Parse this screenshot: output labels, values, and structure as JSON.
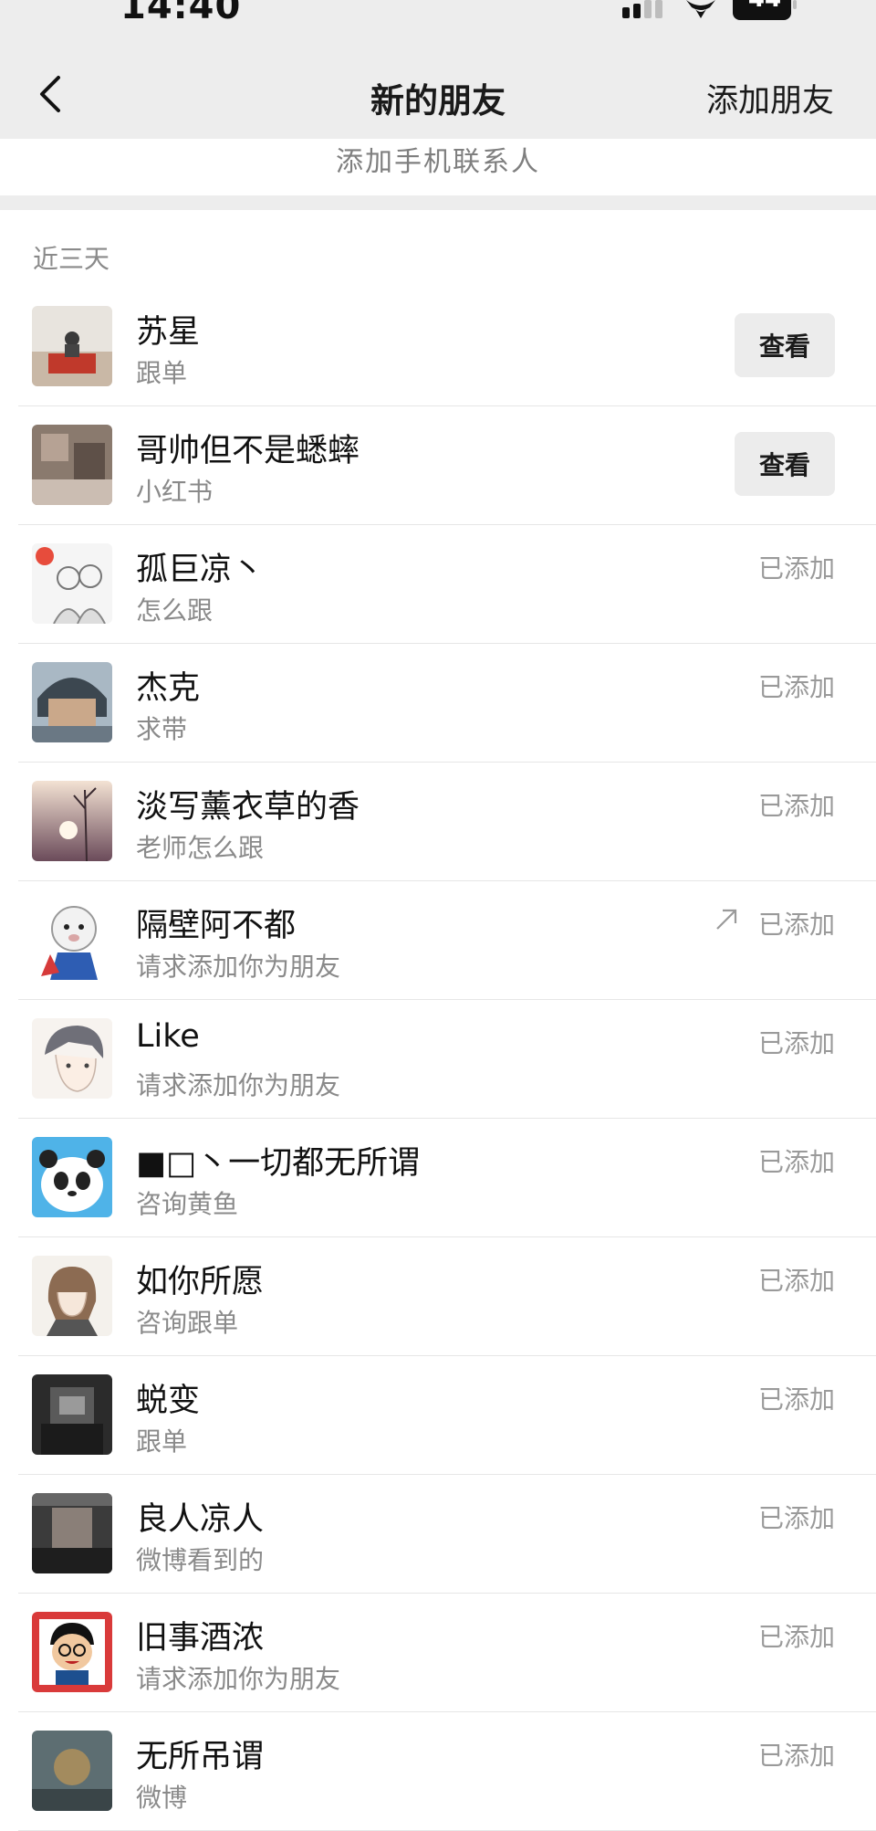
{
  "status_bar": {
    "time": "14:40",
    "battery": "44"
  },
  "nav": {
    "title": "新的朋友",
    "action": "添加朋友",
    "back_icon": "chevron-left-icon"
  },
  "add_contacts": "添加手机联系人",
  "section": "近三天",
  "friends": [
    {
      "name": "苏星",
      "message": "跟单",
      "status": "查看",
      "type": "button"
    },
    {
      "name": "哥帅但不是蟋蟀",
      "message": "小红书",
      "status": "查看",
      "type": "button"
    },
    {
      "name": "孤巨凉丶",
      "message": "怎么跟",
      "status": "已添加",
      "type": "added"
    },
    {
      "name": "杰克",
      "message": "求带",
      "status": "已添加",
      "type": "added"
    },
    {
      "name": "淡写薰衣草的香",
      "message": "老师怎么跟",
      "status": "已添加",
      "type": "added"
    },
    {
      "name": "隔壁阿不都",
      "message": "请求添加你为朋友",
      "status": "已添加",
      "type": "added",
      "arrow": true
    },
    {
      "name": "Like",
      "message": "请求添加你为朋友",
      "status": "已添加",
      "type": "added"
    },
    {
      "name": "■□丶一切都无所谓",
      "message": "咨询黄鱼",
      "status": "已添加",
      "type": "added"
    },
    {
      "name": "如你所愿",
      "message": "咨询跟单",
      "status": "已添加",
      "type": "added"
    },
    {
      "name": "蜕变",
      "message": "跟单",
      "status": "已添加",
      "type": "added"
    },
    {
      "name": "良人凉人",
      "message": "微博看到的",
      "status": "已添加",
      "type": "added"
    },
    {
      "name": "旧事酒浓",
      "message": "请求添加你为朋友",
      "status": "已添加",
      "type": "added"
    },
    {
      "name": "无所吊谓",
      "message": "微博",
      "status": "已添加",
      "type": "added"
    }
  ],
  "colors": {
    "nav_bg": "#ededed",
    "muted_text": "#8a8a8a",
    "button_bg": "#ececec"
  }
}
